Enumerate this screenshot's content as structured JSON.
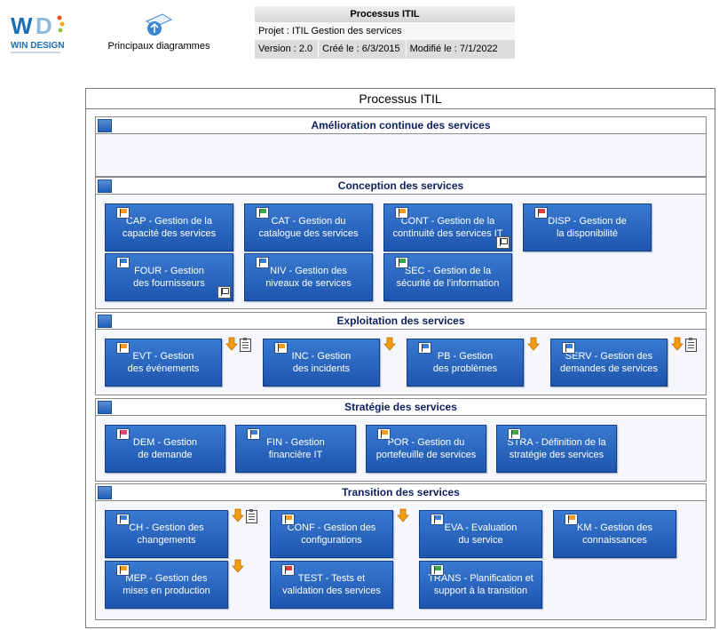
{
  "logo": {
    "text": "WIN DESIGN",
    "colors": [
      "#1a9fd8",
      "#e94e1b",
      "#f6a800",
      "#8cc63f"
    ]
  },
  "principal": {
    "label": "Principaux diagrammes",
    "icon": "up-arrow-diagram-icon"
  },
  "info": {
    "title": "Processus ITIL",
    "project": "Projet : ITIL Gestion des services",
    "version": "Version : 2.0",
    "created": "Créé le : 6/3/2015",
    "modified": "Modifié le : 7/1/2022"
  },
  "diagram": {
    "title": "Processus ITIL",
    "colors": {
      "box": "#2a66c2",
      "flag_orange": "#f29b1d",
      "flag_green": "#3aa64a",
      "flag_red": "#e23b3b",
      "flag_blue": "#3a7fd6",
      "flag_pink": "#e0457a",
      "arrow": "#f39c12"
    },
    "sections": {
      "amelioration": {
        "title": "Amélioration continue des services"
      },
      "conception": {
        "title": "Conception des services",
        "boxes": [
          {
            "label": "CAP - Gestion de la\ncapacité des services",
            "flag": "orange"
          },
          {
            "label": "CAT - Gestion du\ncatalogue des services",
            "flag": "green"
          },
          {
            "label": "CONT - Gestion de la\ncontinuité des services IT",
            "flag": "orange"
          },
          {
            "label": "DISP - Gestion de\nla disponibilité",
            "flag": "red"
          },
          {
            "label": "FOUR - Gestion\ndes fournisseurs",
            "flag": "blue"
          },
          {
            "label": "NIV - Gestion des\nniveaux de services",
            "flag": "blue"
          },
          {
            "label": "SEC - Gestion de la\nsécurité de l'information",
            "flag": "green"
          }
        ]
      },
      "exploitation": {
        "title": "Exploitation des services",
        "boxes": [
          {
            "label": "EVT - Gestion\ndes événements",
            "flag": "orange"
          },
          {
            "label": "INC - Gestion\ndes incidents",
            "flag": "orange"
          },
          {
            "label": "PB - Gestion\ndes problèmes",
            "flag": "blue"
          },
          {
            "label": "SERV - Gestion des\ndemandes de services",
            "flag": "blue"
          }
        ]
      },
      "strategie": {
        "title": "Stratégie des services",
        "boxes": [
          {
            "label": "DEM - Gestion\nde demande",
            "flag": "pink"
          },
          {
            "label": "FIN - Gestion\nfinancière IT",
            "flag": "blue"
          },
          {
            "label": "POR - Gestion du\nportefeuille de services",
            "flag": "orange"
          },
          {
            "label": "STRA - Définition de la\nstratégie des services",
            "flag": "green"
          }
        ]
      },
      "transition": {
        "title": "Transition des services",
        "boxes": [
          {
            "label": "CH - Gestion des\nchangements",
            "flag": "blue"
          },
          {
            "label": "CONF - Gestion des\nconfigurations",
            "flag": "orange"
          },
          {
            "label": "EVA - Evaluation\ndu service",
            "flag": "blue"
          },
          {
            "label": "KM - Gestion des\nconnaissances",
            "flag": "orange"
          },
          {
            "label": "MEP - Gestion des\nmises en production",
            "flag": "orange"
          },
          {
            "label": "TEST - Tests et\nvalidation des services",
            "flag": "red"
          },
          {
            "label": "TRANS - Planification et\nsupport à la transition",
            "flag": "green"
          }
        ]
      }
    }
  }
}
